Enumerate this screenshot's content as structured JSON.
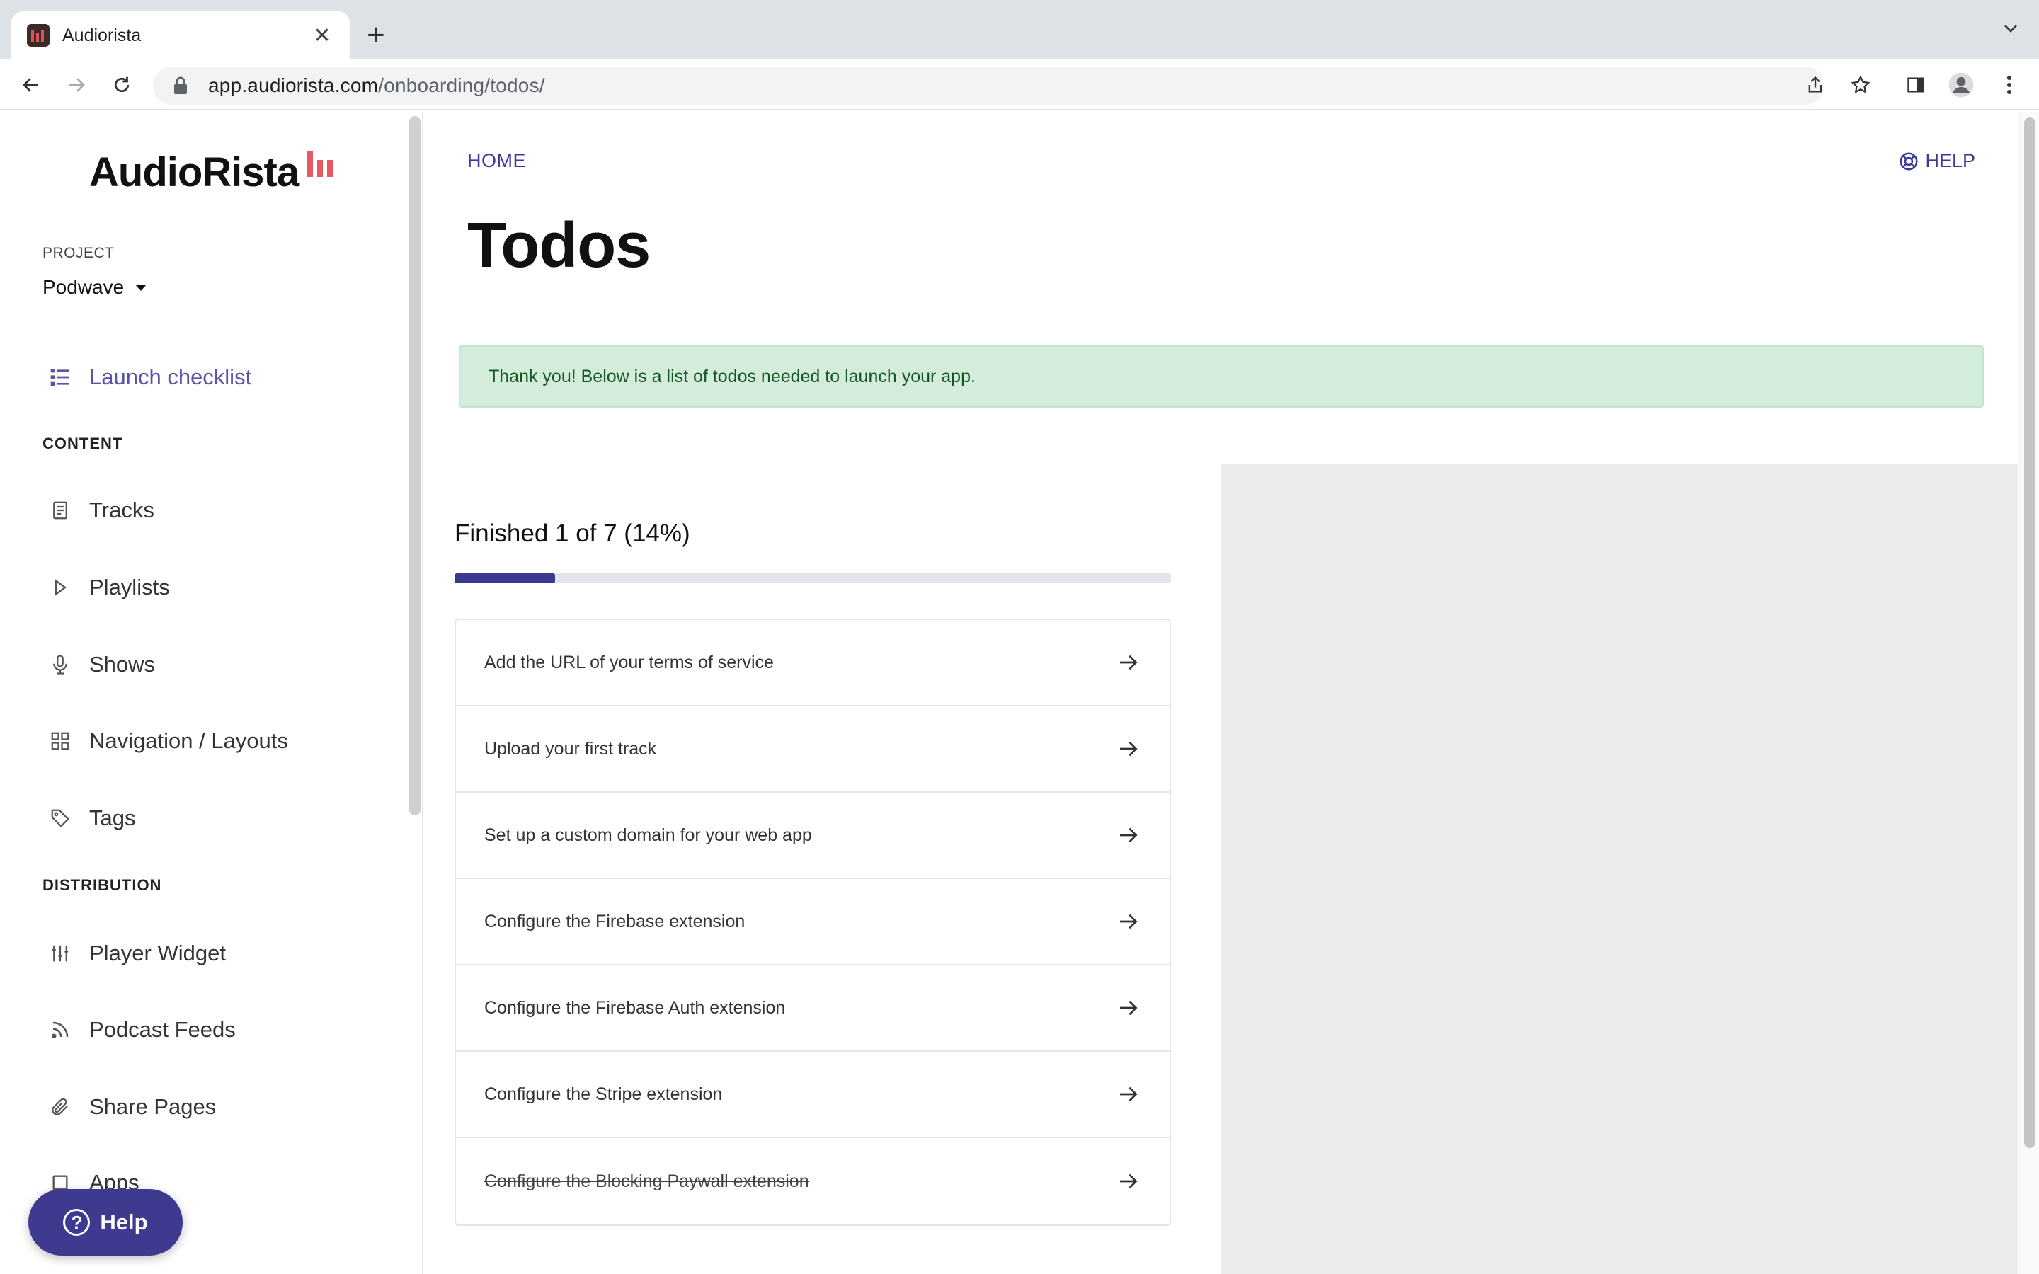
{
  "browser": {
    "tab_title": "Audiorista",
    "url_domain": "app.audiorista.com",
    "url_path": "/onboarding/todos/"
  },
  "sidebar": {
    "logo": "AudioRista",
    "project_label": "PROJECT",
    "project_value": "Podwave",
    "launch_checklist": "Launch checklist",
    "content_section": "CONTENT",
    "content_items": [
      {
        "label": "Tracks",
        "icon": "document-icon"
      },
      {
        "label": "Playlists",
        "icon": "play-icon"
      },
      {
        "label": "Shows",
        "icon": "microphone-icon"
      },
      {
        "label": "Navigation / Layouts",
        "icon": "grid-icon"
      },
      {
        "label": "Tags",
        "icon": "tag-icon"
      }
    ],
    "distribution_section": "DISTRIBUTION",
    "distribution_items": [
      {
        "label": "Player Widget",
        "icon": "sliders-icon"
      },
      {
        "label": "Podcast Feeds",
        "icon": "rss-icon"
      },
      {
        "label": "Share Pages",
        "icon": "paperclip-icon"
      },
      {
        "label": "Apps",
        "icon": "square-icon"
      }
    ],
    "help_button": "Help"
  },
  "main": {
    "breadcrumb_home": "HOME",
    "help_link": "HELP",
    "page_title": "Todos",
    "alert": "Thank you! Below is a list of todos needed to launch your app.",
    "progress_text": "Finished 1 of 7 (14%)",
    "progress_fraction": 0.14,
    "todos": [
      {
        "label": "Add the URL of your terms of service",
        "done": false
      },
      {
        "label": "Upload your first track",
        "done": false
      },
      {
        "label": "Set up a custom domain for your web app",
        "done": false
      },
      {
        "label": "Configure the Firebase extension",
        "done": false
      },
      {
        "label": "Configure the Firebase Auth extension",
        "done": false
      },
      {
        "label": "Configure the Stripe extension",
        "done": false
      },
      {
        "label": "Configure the Blocking Paywall extension",
        "done": true
      }
    ]
  },
  "colors": {
    "accent": "#3b3890",
    "link": "#3c3a99",
    "logo_bars": "#e45a62",
    "alert_bg": "#d4edda",
    "alert_text": "#155724"
  }
}
